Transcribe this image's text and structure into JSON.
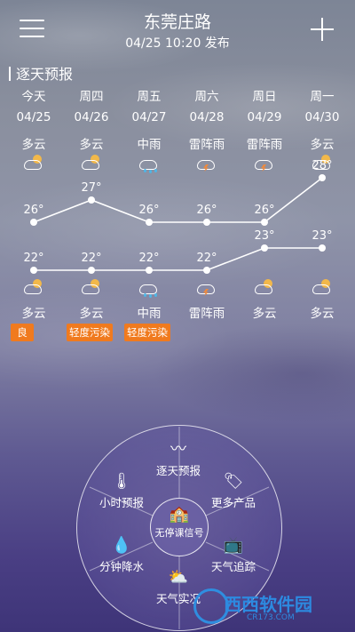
{
  "header": {
    "title": "东莞庄路",
    "subtitle": "04/25  10:20 发布"
  },
  "forecast": {
    "section_title": "逐天预报",
    "days": [
      {
        "weekday": "今天",
        "date": "04/25",
        "day_weather": "多云",
        "night_weather": "多云",
        "high": "26°",
        "low": "22°",
        "day_icon": "partly-cloudy-icon",
        "night_icon": "partly-cloudy-night-icon",
        "aqi": "良"
      },
      {
        "weekday": "周四",
        "date": "04/26",
        "day_weather": "多云",
        "night_weather": "多云",
        "high": "27°",
        "low": "22°",
        "day_icon": "partly-cloudy-icon",
        "night_icon": "partly-cloudy-night-icon",
        "aqi": "轻度污染"
      },
      {
        "weekday": "周五",
        "date": "04/27",
        "day_weather": "中雨",
        "night_weather": "中雨",
        "high": "26°",
        "low": "22°",
        "day_icon": "rain-icon",
        "night_icon": "rain-icon",
        "aqi": "轻度污染"
      },
      {
        "weekday": "周六",
        "date": "04/28",
        "day_weather": "雷阵雨",
        "night_weather": "雷阵雨",
        "high": "26°",
        "low": "22°",
        "day_icon": "thunderstorm-icon",
        "night_icon": "thunderstorm-icon",
        "aqi": ""
      },
      {
        "weekday": "周日",
        "date": "04/29",
        "day_weather": "雷阵雨",
        "night_weather": "多云",
        "high": "26°",
        "low": "23°",
        "day_icon": "thunderstorm-icon",
        "night_icon": "partly-cloudy-night-icon",
        "aqi": ""
      },
      {
        "weekday": "周一",
        "date": "04/30",
        "day_weather": "多云",
        "night_weather": "多云",
        "high": "28°",
        "low": "23°",
        "day_icon": "partly-cloudy-icon",
        "night_icon": "partly-cloudy-night-icon",
        "aqi": ""
      }
    ],
    "aqi_color": "#f07a1e"
  },
  "chart_data": {
    "type": "line",
    "categories": [
      "04/25",
      "04/26",
      "04/27",
      "04/28",
      "04/29",
      "04/30"
    ],
    "series": [
      {
        "values": [
          26,
          27,
          26,
          26,
          26,
          28
        ]
      },
      {
        "values": [
          22,
          22,
          22,
          22,
          23,
          23
        ]
      }
    ],
    "ylim": [
      20,
      30
    ],
    "grid": false
  },
  "menu": {
    "center_label": "无停课信号",
    "items": [
      {
        "label": "逐天预报",
        "icon": "trend-icon"
      },
      {
        "label": "更多产品",
        "icon": "tag-icon"
      },
      {
        "label": "天气追踪",
        "icon": "tv-icon"
      },
      {
        "label": "天气实况",
        "icon": "sun-cloud-icon"
      },
      {
        "label": "分钟降水",
        "icon": "raindrops-icon"
      },
      {
        "label": "小时预报",
        "icon": "thermometer-icon"
      }
    ]
  },
  "watermark": {
    "text": "西西软件园",
    "sub": "CR173.COM"
  }
}
